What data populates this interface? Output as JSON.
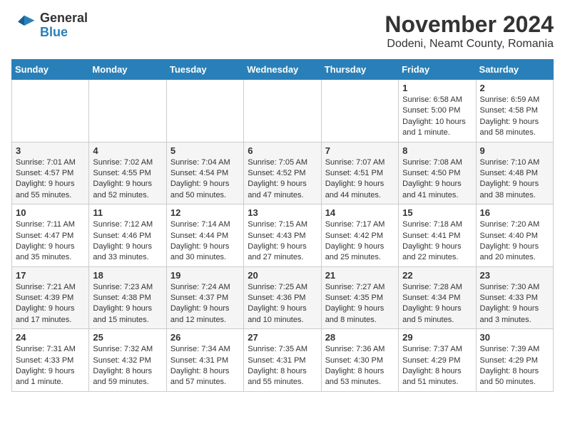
{
  "logo": {
    "line1": "General",
    "line2": "Blue"
  },
  "header": {
    "month": "November 2024",
    "location": "Dodeni, Neamt County, Romania"
  },
  "weekdays": [
    "Sunday",
    "Monday",
    "Tuesday",
    "Wednesday",
    "Thursday",
    "Friday",
    "Saturday"
  ],
  "weeks": [
    [
      {
        "day": "",
        "info": ""
      },
      {
        "day": "",
        "info": ""
      },
      {
        "day": "",
        "info": ""
      },
      {
        "day": "",
        "info": ""
      },
      {
        "day": "",
        "info": ""
      },
      {
        "day": "1",
        "info": "Sunrise: 6:58 AM\nSunset: 5:00 PM\nDaylight: 10 hours and 1 minute."
      },
      {
        "day": "2",
        "info": "Sunrise: 6:59 AM\nSunset: 4:58 PM\nDaylight: 9 hours and 58 minutes."
      }
    ],
    [
      {
        "day": "3",
        "info": "Sunrise: 7:01 AM\nSunset: 4:57 PM\nDaylight: 9 hours and 55 minutes."
      },
      {
        "day": "4",
        "info": "Sunrise: 7:02 AM\nSunset: 4:55 PM\nDaylight: 9 hours and 52 minutes."
      },
      {
        "day": "5",
        "info": "Sunrise: 7:04 AM\nSunset: 4:54 PM\nDaylight: 9 hours and 50 minutes."
      },
      {
        "day": "6",
        "info": "Sunrise: 7:05 AM\nSunset: 4:52 PM\nDaylight: 9 hours and 47 minutes."
      },
      {
        "day": "7",
        "info": "Sunrise: 7:07 AM\nSunset: 4:51 PM\nDaylight: 9 hours and 44 minutes."
      },
      {
        "day": "8",
        "info": "Sunrise: 7:08 AM\nSunset: 4:50 PM\nDaylight: 9 hours and 41 minutes."
      },
      {
        "day": "9",
        "info": "Sunrise: 7:10 AM\nSunset: 4:48 PM\nDaylight: 9 hours and 38 minutes."
      }
    ],
    [
      {
        "day": "10",
        "info": "Sunrise: 7:11 AM\nSunset: 4:47 PM\nDaylight: 9 hours and 35 minutes."
      },
      {
        "day": "11",
        "info": "Sunrise: 7:12 AM\nSunset: 4:46 PM\nDaylight: 9 hours and 33 minutes."
      },
      {
        "day": "12",
        "info": "Sunrise: 7:14 AM\nSunset: 4:44 PM\nDaylight: 9 hours and 30 minutes."
      },
      {
        "day": "13",
        "info": "Sunrise: 7:15 AM\nSunset: 4:43 PM\nDaylight: 9 hours and 27 minutes."
      },
      {
        "day": "14",
        "info": "Sunrise: 7:17 AM\nSunset: 4:42 PM\nDaylight: 9 hours and 25 minutes."
      },
      {
        "day": "15",
        "info": "Sunrise: 7:18 AM\nSunset: 4:41 PM\nDaylight: 9 hours and 22 minutes."
      },
      {
        "day": "16",
        "info": "Sunrise: 7:20 AM\nSunset: 4:40 PM\nDaylight: 9 hours and 20 minutes."
      }
    ],
    [
      {
        "day": "17",
        "info": "Sunrise: 7:21 AM\nSunset: 4:39 PM\nDaylight: 9 hours and 17 minutes."
      },
      {
        "day": "18",
        "info": "Sunrise: 7:23 AM\nSunset: 4:38 PM\nDaylight: 9 hours and 15 minutes."
      },
      {
        "day": "19",
        "info": "Sunrise: 7:24 AM\nSunset: 4:37 PM\nDaylight: 9 hours and 12 minutes."
      },
      {
        "day": "20",
        "info": "Sunrise: 7:25 AM\nSunset: 4:36 PM\nDaylight: 9 hours and 10 minutes."
      },
      {
        "day": "21",
        "info": "Sunrise: 7:27 AM\nSunset: 4:35 PM\nDaylight: 9 hours and 8 minutes."
      },
      {
        "day": "22",
        "info": "Sunrise: 7:28 AM\nSunset: 4:34 PM\nDaylight: 9 hours and 5 minutes."
      },
      {
        "day": "23",
        "info": "Sunrise: 7:30 AM\nSunset: 4:33 PM\nDaylight: 9 hours and 3 minutes."
      }
    ],
    [
      {
        "day": "24",
        "info": "Sunrise: 7:31 AM\nSunset: 4:33 PM\nDaylight: 9 hours and 1 minute."
      },
      {
        "day": "25",
        "info": "Sunrise: 7:32 AM\nSunset: 4:32 PM\nDaylight: 8 hours and 59 minutes."
      },
      {
        "day": "26",
        "info": "Sunrise: 7:34 AM\nSunset: 4:31 PM\nDaylight: 8 hours and 57 minutes."
      },
      {
        "day": "27",
        "info": "Sunrise: 7:35 AM\nSunset: 4:31 PM\nDaylight: 8 hours and 55 minutes."
      },
      {
        "day": "28",
        "info": "Sunrise: 7:36 AM\nSunset: 4:30 PM\nDaylight: 8 hours and 53 minutes."
      },
      {
        "day": "29",
        "info": "Sunrise: 7:37 AM\nSunset: 4:29 PM\nDaylight: 8 hours and 51 minutes."
      },
      {
        "day": "30",
        "info": "Sunrise: 7:39 AM\nSunset: 4:29 PM\nDaylight: 8 hours and 50 minutes."
      }
    ]
  ]
}
